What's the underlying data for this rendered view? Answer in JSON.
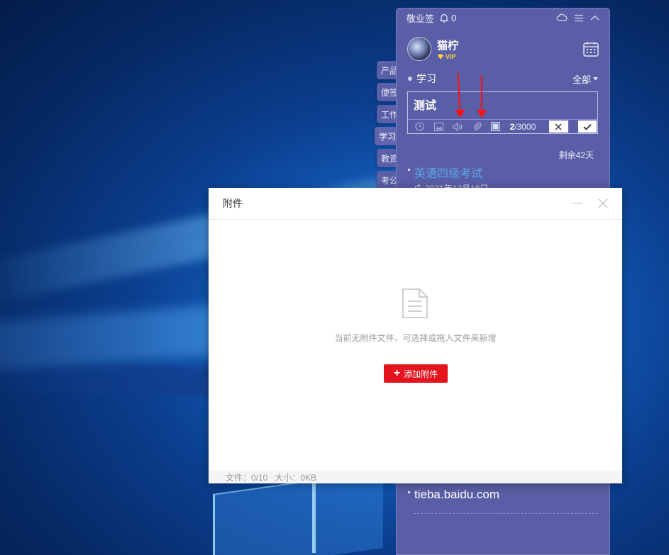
{
  "panel": {
    "app_name": "敬业签",
    "notification_count": "0",
    "username": "猫柠",
    "vip_label": "VIP",
    "category": "学习",
    "filter_label": "全部",
    "editor_text": "测试",
    "char_count": "2",
    "char_limit": "/3000",
    "remaining_label": "剩余42天",
    "note_title": "英语四级考试",
    "note_date": "2021年12月18日",
    "link_text": "tieba.baidu.com"
  },
  "side_tabs": [
    {
      "label": "产品",
      "active": false
    },
    {
      "label": "便签",
      "active": false
    },
    {
      "label": "工作",
      "active": false
    },
    {
      "label": "学习",
      "active": true
    },
    {
      "label": "教资",
      "active": false
    },
    {
      "label": "考公",
      "active": false
    }
  ],
  "dialog": {
    "title": "附件",
    "empty_message": "当前无附件文件，可选择或拖入文件来新增",
    "add_button_label": "添加附件",
    "file_count": "文件：0/10",
    "size_label": "大小：0KB"
  },
  "colors": {
    "panel_bg": "#5a5ea6",
    "add_button": "#e3141d",
    "arrow": "#ff1010",
    "note_title": "#5aa7e6",
    "vip": "#ffd23a"
  }
}
